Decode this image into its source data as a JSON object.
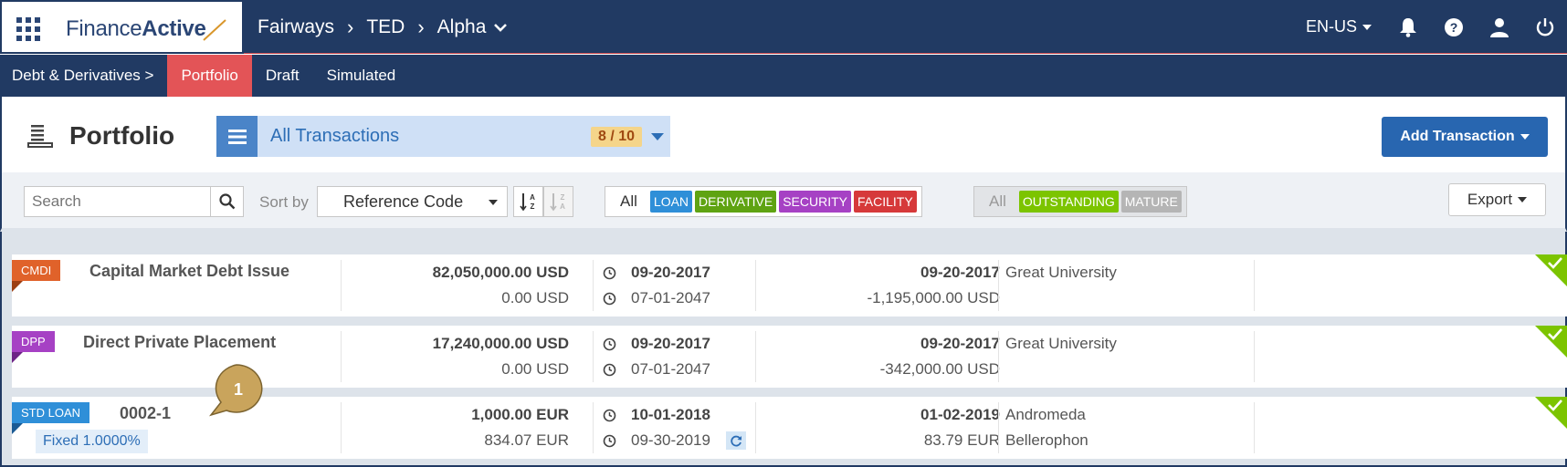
{
  "app": {
    "logo_light": "Finance",
    "logo_bold": "Active",
    "breadcrumbs": [
      "Fairways",
      "TED",
      "Alpha"
    ],
    "language": "EN-US",
    "icons": [
      "bell-icon",
      "help-icon",
      "user-icon",
      "power-icon"
    ]
  },
  "subnav": {
    "section": "Debt & Derivatives >",
    "tabs": [
      "Portfolio",
      "Draft",
      "Simulated"
    ],
    "active": "Portfolio"
  },
  "header": {
    "title": "Portfolio",
    "view_label": "All Transactions",
    "view_count": "8 / 10",
    "add_label": "Add Transaction"
  },
  "toolbar": {
    "search_placeholder": "Search",
    "sort_by_label": "Sort by",
    "sort_value": "Reference Code",
    "type_filter": {
      "all": "All",
      "tags": [
        {
          "label": "LOAN",
          "color": "#2f8fd8"
        },
        {
          "label": "DERIVATIVE",
          "color": "#5fa312"
        },
        {
          "label": "SECURITY",
          "color": "#a641c4"
        },
        {
          "label": "FACILITY",
          "color": "#d6393a"
        }
      ]
    },
    "status_filter": {
      "all": "All",
      "tags": [
        {
          "label": "OUTSTANDING",
          "color": "#7cc400"
        },
        {
          "label": "MATURE",
          "color": "#b5b5b5"
        }
      ]
    },
    "export_label": "Export"
  },
  "rows": [
    {
      "badge": "CMDI",
      "badge_color": "#e0622a",
      "fold_color": "#9c3e12",
      "title": "Capital Market Debt Issue",
      "rate": "",
      "amount": "82,050,000.00 USD",
      "amount2": "0.00 USD",
      "date1": "09-20-2017",
      "date2": "07-01-2047",
      "rdate": "09-20-2017",
      "ramount": "-1,195,000.00 USD",
      "counterparty1": "Great University",
      "counterparty2": ""
    },
    {
      "badge": "DPP",
      "badge_color": "#a641c4",
      "fold_color": "#6d2386",
      "title": "Direct Private Placement",
      "rate": "",
      "amount": "17,240,000.00 USD",
      "amount2": "0.00 USD",
      "date1": "09-20-2017",
      "date2": "07-01-2047",
      "rdate": "09-20-2017",
      "ramount": "-342,000.00 USD",
      "counterparty1": "Great University",
      "counterparty2": ""
    },
    {
      "badge": "STD LOAN",
      "badge_color": "#2f8fd8",
      "fold_color": "#1b5a94",
      "title": "0002-1",
      "rate": "Fixed 1.0000%",
      "amount": "1,000.00 EUR",
      "amount2": "834.07 EUR",
      "date1": "10-01-2018",
      "date2": "09-30-2019",
      "rdate": "01-02-2019",
      "ramount": "83.79 EUR",
      "counterparty1": "Andromeda",
      "counterparty2": "Bellerophon"
    }
  ],
  "callout": {
    "number": "1"
  }
}
